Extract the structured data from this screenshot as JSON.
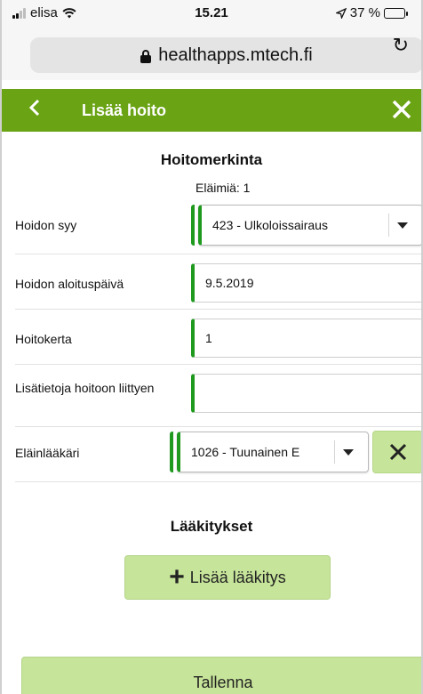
{
  "status_bar": {
    "carrier": "elisa",
    "time": "15.21",
    "battery_text": "37 %",
    "battery_level": 0.37
  },
  "browser": {
    "url": "healthapps.mtech.fi"
  },
  "header": {
    "title": "Lisää hoito"
  },
  "treatment": {
    "section_title": "Hoitomerkinta",
    "animals_label": "Eläimiä: 1",
    "fields": {
      "reason": {
        "label": "Hoidon syy",
        "value": "423 - Ulkoloissairaus"
      },
      "start_date": {
        "label": "Hoidon aloituspäivä",
        "value": "9.5.2019"
      },
      "count": {
        "label": "Hoitokerta",
        "value": "1"
      },
      "notes": {
        "label": "Lisätietoja hoitoon liittyen",
        "value": ""
      },
      "vet": {
        "label": "Eläinlääkäri",
        "value": "1026 - Tuunainen E"
      }
    }
  },
  "medications": {
    "section_title": "Lääkitykset",
    "add_label": "Lisää lääkitys"
  },
  "save_label": "Tallenna",
  "colors": {
    "header_green": "#6aa314",
    "required_marker": "#1f9a1f",
    "button_light_green": "#c7e59a"
  }
}
